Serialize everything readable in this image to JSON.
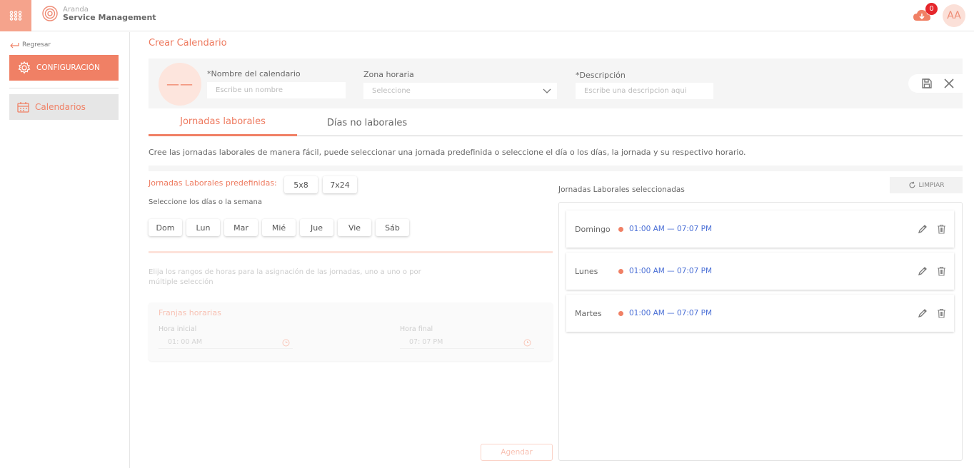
{
  "app": {
    "brand_line1": "Aranda",
    "brand_line2": "Service Management",
    "notifications": "0",
    "user_initials": "AA",
    "accent": "#f08065"
  },
  "sidebar": {
    "back_label": "Regresar",
    "config_label": "CONFIGURACIÓN",
    "calendars_label": "Calendarios"
  },
  "page": {
    "title": "Crear Calendario",
    "avatar_placeholder": "——"
  },
  "form": {
    "name_label": "*Nombre del calendario",
    "name_placeholder": "Escribe un nombre",
    "timezone_label": "Zona horaria",
    "timezone_placeholder": "Seleccione",
    "description_label": "*Descripción",
    "description_placeholder": "Escribe una descripcion aqui"
  },
  "tabs": [
    {
      "label": "Jornadas laborales"
    },
    {
      "label": "Días no laborales"
    }
  ],
  "intro": "Cree las jornadas laborales de manera fácil, puede seleccionar una jornada predefinida o seleccione el día o los días, la jornada y su respectivo horario.",
  "predefined": {
    "label": "Jornadas Laborales predefinidas:",
    "options": [
      "5x8",
      "7x24"
    ]
  },
  "days": {
    "label": "Seleccione los días o la semana",
    "items": [
      "Dom",
      "Lun",
      "Mar",
      "Mié",
      "Jue",
      "Vie",
      "Sáb"
    ]
  },
  "ranges": {
    "hint": "Elija los rangos de horas para la asignación de las jornadas, uno a uno o por múltiple selección",
    "title": "Franjas horarias",
    "start_label": "Hora inicial",
    "start_value": "01: 00 AM",
    "end_label": "Hora final",
    "end_value": "07: 07 PM"
  },
  "agendar_label": "Agendar",
  "selected": {
    "label": "Jornadas Laborales seleccionadas",
    "clear_label": "LIMPIAR",
    "rows": [
      {
        "day": "Domingo",
        "time": "01:00 AM — 07:07 PM"
      },
      {
        "day": "Lunes",
        "time": "01:00 AM — 07:07 PM"
      },
      {
        "day": "Martes",
        "time": "01:00 AM — 07:07 PM"
      }
    ]
  }
}
